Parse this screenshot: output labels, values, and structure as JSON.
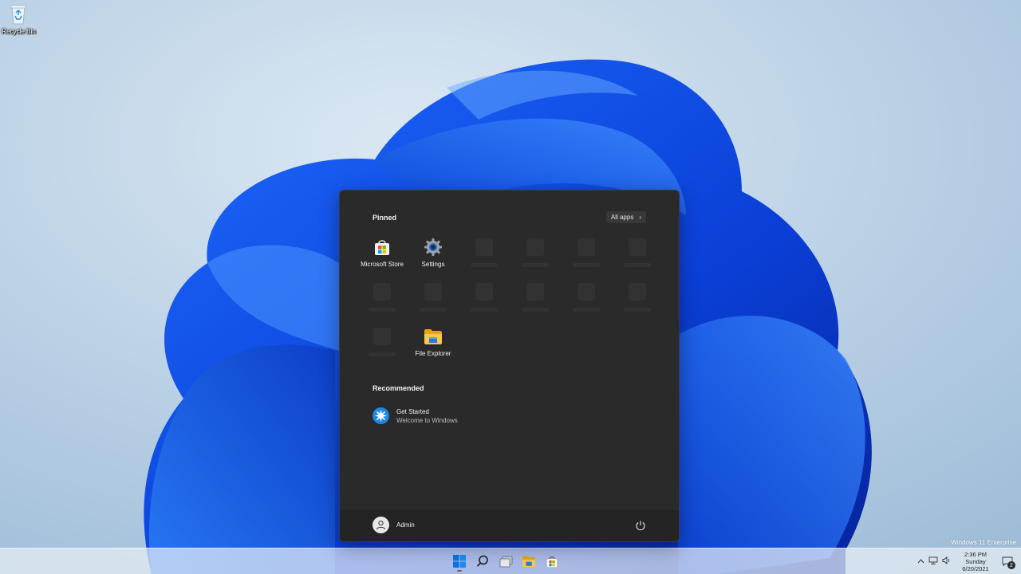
{
  "desktop": {
    "icons": [
      {
        "label": "Recycle Bin",
        "icon": "recycle-bin-icon"
      }
    ],
    "watermark": "Windows 11 Enterprise"
  },
  "start_menu": {
    "pinned_title": "Pinned",
    "all_apps_label": "All apps",
    "all_apps_icon": "chevron-right-icon",
    "pinned": [
      {
        "label": "Microsoft Store",
        "icon": "microsoft-store-icon"
      },
      {
        "label": "Settings",
        "icon": "settings-gear-icon"
      },
      {
        "label": "",
        "icon": "placeholder"
      },
      {
        "label": "",
        "icon": "placeholder"
      },
      {
        "label": "",
        "icon": "placeholder"
      },
      {
        "label": "",
        "icon": "placeholder"
      },
      {
        "label": "",
        "icon": "placeholder"
      },
      {
        "label": "",
        "icon": "placeholder"
      },
      {
        "label": "",
        "icon": "placeholder"
      },
      {
        "label": "",
        "icon": "placeholder"
      },
      {
        "label": "",
        "icon": "placeholder"
      },
      {
        "label": "",
        "icon": "placeholder"
      },
      {
        "label": "",
        "icon": "placeholder"
      },
      {
        "label": "File Explorer",
        "icon": "file-explorer-icon"
      }
    ],
    "recommended_title": "Recommended",
    "recommended": [
      {
        "title": "Get Started",
        "subtitle": "Welcome to Windows",
        "icon": "get-started-icon"
      }
    ],
    "user": {
      "name": "Admin",
      "icon": "user-avatar-icon"
    },
    "power_icon": "power-icon"
  },
  "taskbar": {
    "apps": [
      {
        "name": "Start",
        "icon": "windows-start-icon",
        "active": true
      },
      {
        "name": "Search",
        "icon": "search-icon",
        "active": false
      },
      {
        "name": "Task View",
        "icon": "task-view-icon",
        "active": false
      },
      {
        "name": "File Explorer",
        "icon": "file-explorer-icon",
        "active": false
      },
      {
        "name": "Microsoft Store",
        "icon": "microsoft-store-icon",
        "active": false
      }
    ],
    "tray_icons": [
      "chevron-up-icon",
      "network-icon",
      "volume-icon"
    ],
    "clock": {
      "time": "2:36 PM",
      "day": "Sunday",
      "date": "6/20/2021"
    },
    "notification_count": "2"
  },
  "colors": {
    "accent": "#0078d4",
    "start_menu_bg": "#2a2a2a",
    "folder_yellow": "#f5c242"
  }
}
